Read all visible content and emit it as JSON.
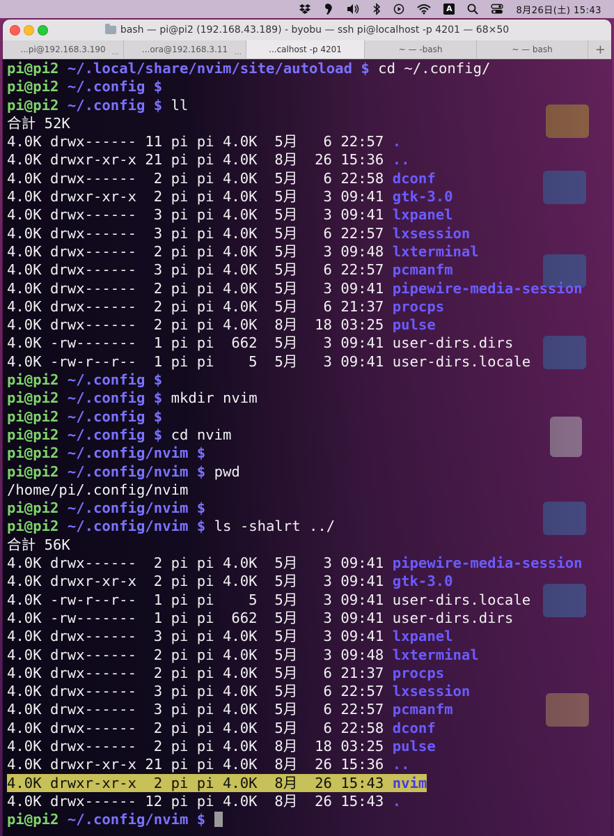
{
  "menubar": {
    "input_indicator": "A",
    "clock": "8月26日(土)  15:43"
  },
  "window": {
    "title": "bash — pi@pi2 (192.168.43.189) - byobu — ssh pi@localhost -p 4201 — 68×50",
    "tabs": [
      {
        "label": "...pi@192.168.3.190",
        "active": false,
        "dots": "..."
      },
      {
        "label": "...ora@192.168.3.11",
        "active": false,
        "dots": "..."
      },
      {
        "label": "...calhost -p 4201",
        "active": true,
        "dots": ""
      },
      {
        "label": "~ — -bash",
        "active": false,
        "dots": ""
      },
      {
        "label": "~ — bash",
        "active": false,
        "dots": ""
      }
    ],
    "add_tab": "+"
  },
  "terminal": {
    "lines": [
      {
        "type": "prompt",
        "user": "pi@pi2",
        "path": "~/.local/share/nvim/site/autoload",
        "cmd": " cd ~/.config/"
      },
      {
        "type": "prompt",
        "user": "pi@pi2",
        "path": "~/.config",
        "cmd": ""
      },
      {
        "type": "prompt",
        "user": "pi@pi2",
        "path": "~/.config",
        "cmd": " ll"
      },
      {
        "type": "text",
        "text": "合計 52K"
      },
      {
        "type": "entry",
        "info": "4.0K drwx------ 11 pi pi 4.0K  5月   6 22:57 ",
        "name": ".",
        "dir": true
      },
      {
        "type": "entry",
        "info": "4.0K drwxr-xr-x 21 pi pi 4.0K  8月  26 15:36 ",
        "name": "..",
        "dir": true
      },
      {
        "type": "entry",
        "info": "4.0K drwx------  2 pi pi 4.0K  5月   6 22:58 ",
        "name": "dconf",
        "dir": true
      },
      {
        "type": "entry",
        "info": "4.0K drwxr-xr-x  2 pi pi 4.0K  5月   3 09:41 ",
        "name": "gtk-3.0",
        "dir": true
      },
      {
        "type": "entry",
        "info": "4.0K drwx------  3 pi pi 4.0K  5月   3 09:41 ",
        "name": "lxpanel",
        "dir": true
      },
      {
        "type": "entry",
        "info": "4.0K drwx------  3 pi pi 4.0K  5月   6 22:57 ",
        "name": "lxsession",
        "dir": true
      },
      {
        "type": "entry",
        "info": "4.0K drwx------  2 pi pi 4.0K  5月   3 09:48 ",
        "name": "lxterminal",
        "dir": true
      },
      {
        "type": "entry",
        "info": "4.0K drwx------  3 pi pi 4.0K  5月   6 22:57 ",
        "name": "pcmanfm",
        "dir": true
      },
      {
        "type": "entry",
        "info": "4.0K drwx------  2 pi pi 4.0K  5月   3 09:41 ",
        "name": "pipewire-media-session",
        "dir": true
      },
      {
        "type": "entry",
        "info": "4.0K drwx------  2 pi pi 4.0K  5月   6 21:37 ",
        "name": "procps",
        "dir": true
      },
      {
        "type": "entry",
        "info": "4.0K drwx------  2 pi pi 4.0K  8月  18 03:25 ",
        "name": "pulse",
        "dir": true
      },
      {
        "type": "entry",
        "info": "4.0K -rw-------  1 pi pi  662  5月   3 09:41 ",
        "name": "user-dirs.dirs",
        "dir": false
      },
      {
        "type": "entry",
        "info": "4.0K -rw-r--r--  1 pi pi    5  5月   3 09:41 ",
        "name": "user-dirs.locale",
        "dir": false
      },
      {
        "type": "prompt",
        "user": "pi@pi2",
        "path": "~/.config",
        "cmd": ""
      },
      {
        "type": "prompt",
        "user": "pi@pi2",
        "path": "~/.config",
        "cmd": " mkdir nvim"
      },
      {
        "type": "prompt",
        "user": "pi@pi2",
        "path": "~/.config",
        "cmd": ""
      },
      {
        "type": "prompt",
        "user": "pi@pi2",
        "path": "~/.config",
        "cmd": " cd nvim"
      },
      {
        "type": "prompt",
        "user": "pi@pi2",
        "path": "~/.config/nvim",
        "cmd": ""
      },
      {
        "type": "prompt",
        "user": "pi@pi2",
        "path": "~/.config/nvim",
        "cmd": " pwd"
      },
      {
        "type": "text",
        "text": "/home/pi/.config/nvim"
      },
      {
        "type": "prompt",
        "user": "pi@pi2",
        "path": "~/.config/nvim",
        "cmd": ""
      },
      {
        "type": "prompt",
        "user": "pi@pi2",
        "path": "~/.config/nvim",
        "cmd": " ls -shalrt ../"
      },
      {
        "type": "text",
        "text": "合計 56K"
      },
      {
        "type": "entry",
        "info": "4.0K drwx------  2 pi pi 4.0K  5月   3 09:41 ",
        "name": "pipewire-media-session",
        "dir": true
      },
      {
        "type": "entry",
        "info": "4.0K drwxr-xr-x  2 pi pi 4.0K  5月   3 09:41 ",
        "name": "gtk-3.0",
        "dir": true
      },
      {
        "type": "entry",
        "info": "4.0K -rw-r--r--  1 pi pi    5  5月   3 09:41 ",
        "name": "user-dirs.locale",
        "dir": false
      },
      {
        "type": "entry",
        "info": "4.0K -rw-------  1 pi pi  662  5月   3 09:41 ",
        "name": "user-dirs.dirs",
        "dir": false
      },
      {
        "type": "entry",
        "info": "4.0K drwx------  3 pi pi 4.0K  5月   3 09:41 ",
        "name": "lxpanel",
        "dir": true
      },
      {
        "type": "entry",
        "info": "4.0K drwx------  2 pi pi 4.0K  5月   3 09:48 ",
        "name": "lxterminal",
        "dir": true
      },
      {
        "type": "entry",
        "info": "4.0K drwx------  2 pi pi 4.0K  5月   6 21:37 ",
        "name": "procps",
        "dir": true
      },
      {
        "type": "entry",
        "info": "4.0K drwx------  3 pi pi 4.0K  5月   6 22:57 ",
        "name": "lxsession",
        "dir": true
      },
      {
        "type": "entry",
        "info": "4.0K drwx------  3 pi pi 4.0K  5月   6 22:57 ",
        "name": "pcmanfm",
        "dir": true
      },
      {
        "type": "entry",
        "info": "4.0K drwx------  2 pi pi 4.0K  5月   6 22:58 ",
        "name": "dconf",
        "dir": true
      },
      {
        "type": "entry",
        "info": "4.0K drwx------  2 pi pi 4.0K  8月  18 03:25 ",
        "name": "pulse",
        "dir": true
      },
      {
        "type": "entry",
        "info": "4.0K drwxr-xr-x 21 pi pi 4.0K  8月  26 15:36 ",
        "name": "..",
        "dir": true
      },
      {
        "type": "entry",
        "info": "4.0K drwxr-xr-x  2 pi pi 4.0K  8月  26 15:43 ",
        "name": "nvim",
        "dir": true,
        "highlight": true
      },
      {
        "type": "entry",
        "info": "4.0K drwx------ 12 pi pi 4.0K  8月  26 15:43 ",
        "name": ".",
        "dir": true
      },
      {
        "type": "prompt",
        "user": "pi@pi2",
        "path": "~/.config/nvim",
        "cmd": " ",
        "cursor": true
      }
    ]
  },
  "colors": {
    "prompt_user": "#7fd66a",
    "prompt_path": "#7b73ff",
    "directory": "#6b5cff",
    "highlight": "#c8c058"
  }
}
